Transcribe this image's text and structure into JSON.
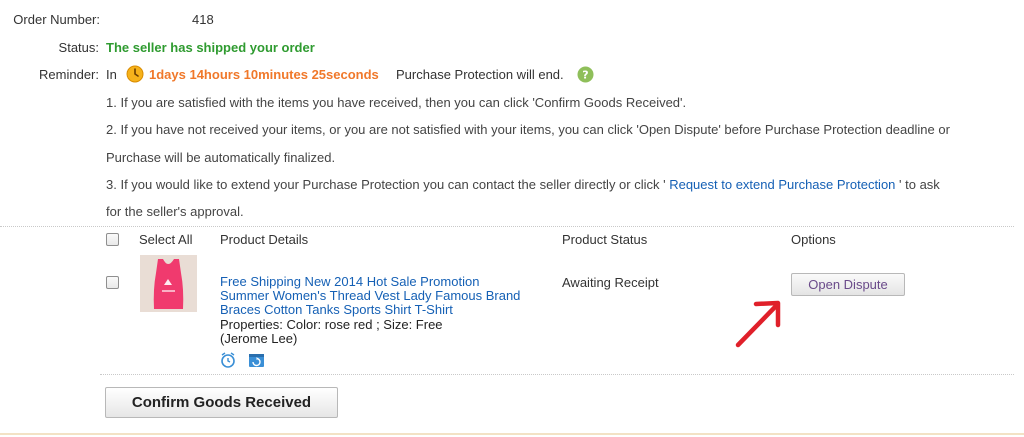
{
  "order": {
    "number_label": "Order Number:",
    "number_value": "418",
    "status_label": "Status:",
    "status_value": "The seller has shipped your order",
    "reminder_label": "Reminder:",
    "reminder_in": "In",
    "countdown": "1days 14hours 10minutes 25seconds",
    "reminder_suffix": "Purchase Protection will end.",
    "help_icon": "question-icon",
    "clock_icon": "clock-icon"
  },
  "instructions": {
    "line1": "1. If you are satisfied with the items you have received, then you can click 'Confirm Goods Received'.",
    "line2a": "2. If you have not received your items, or you are not satisfied with your items, you can click 'Open Dispute' before Purchase Protection deadline or",
    "line2b": "Purchase will be automatically finalized.",
    "line3_prefix": "3. If you would like to extend your Purchase Protection you can contact the seller directly or click '",
    "line3_link": " Request to extend Purchase Protection ",
    "line3_suffix": "' to ask",
    "line3b": "for the seller's approval."
  },
  "table": {
    "headers": {
      "select_all": "Select All",
      "product_details": "Product Details",
      "product_status": "Product Status",
      "options": "Options"
    },
    "row": {
      "title_line1": "Free Shipping New 2014 Hot Sale Promotion",
      "title_line2": "Summer Women's Thread Vest Lady Famous Brand",
      "title_line3": "Braces Cotton Tanks Sports Shirt T-Shirt",
      "properties": "Properties: Color: rose red   ; Size: Free",
      "seller": "(Jerome Lee)",
      "status": "Awaiting Receipt",
      "dispute_button": "Open Dispute",
      "icons": [
        "alarm-clock-icon",
        "calendar-refresh-icon"
      ]
    }
  },
  "actions": {
    "confirm_button": "Confirm Goods Received"
  },
  "annotation": {
    "arrow_color": "#e0202a"
  }
}
